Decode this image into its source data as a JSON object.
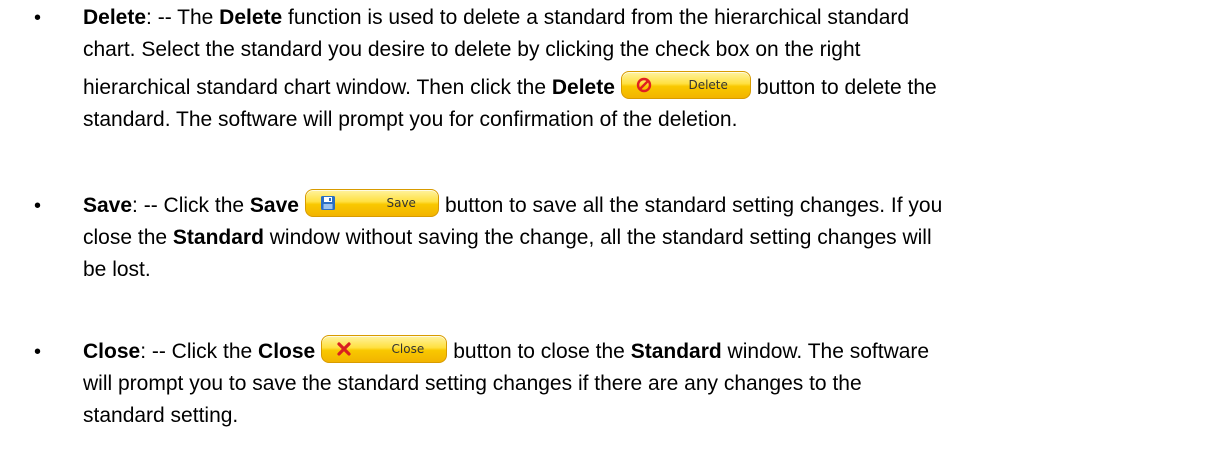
{
  "items": [
    {
      "term": "Delete",
      "sep": ": -- The ",
      "term2": "Delete",
      "line1_rest": " function is used to delete a standard from the hierarchical standard",
      "line2": "chart. Select the standard you desire to delete by clicking the check box on the right",
      "line3_pre": "hierarchical standard chart window. Then click the ",
      "term3": "Delete",
      "button_label": "Delete",
      "button_icon": "no-entry-icon",
      "line3_post": "button to delete the",
      "line4": "standard. The software will prompt you for confirmation of the deletion."
    },
    {
      "term": "Save",
      "sep": ": -- Click the ",
      "term2": "Save",
      "button_label": "Save",
      "button_icon": "floppy-disk-icon",
      "line1_post": "button to save all the standard setting changes. If you",
      "line2_pre": "close the ",
      "term3": "Standard",
      "line2_post": " window without saving the change, all the standard setting changes will",
      "line3": "be lost."
    },
    {
      "term": "Close",
      "sep": ": -- Click the ",
      "term2": "Close",
      "button_label": "Close",
      "button_icon": "red-x-icon",
      "line1_mid": "button to close the ",
      "term3": "Standard",
      "line1_post": " window. The software",
      "line2": "will prompt you to save the standard setting changes if there are any changes to the",
      "line3": "standard setting."
    }
  ],
  "bullet": "•",
  "colors": {
    "button_fill": "#f9c800",
    "button_border": "#d89b00"
  }
}
